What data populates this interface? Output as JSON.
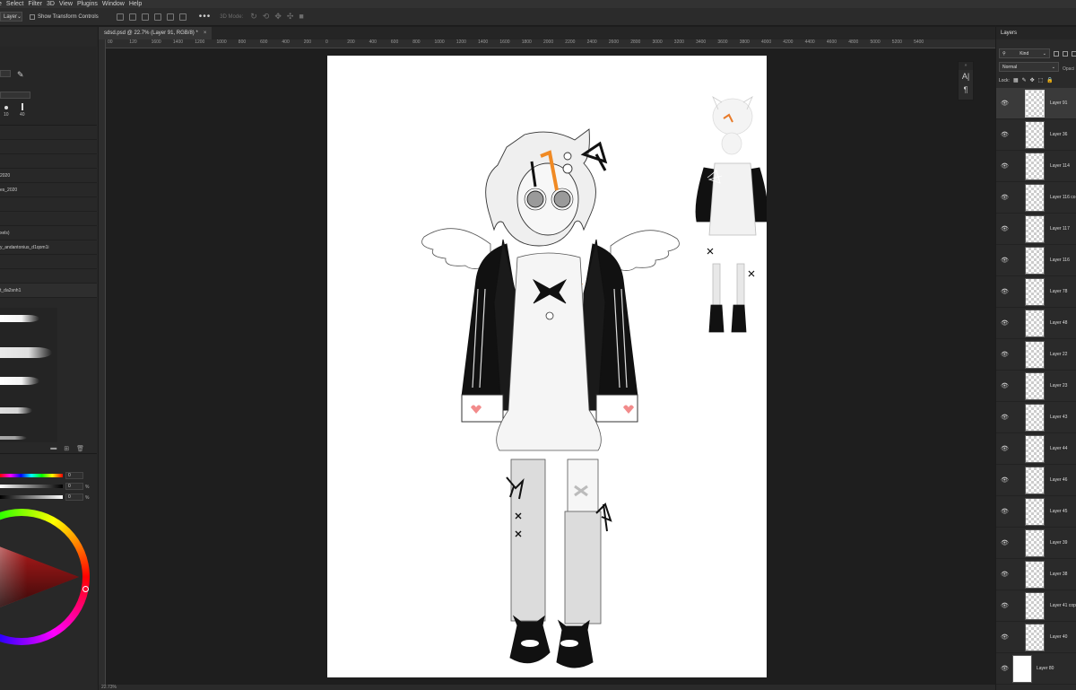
{
  "menu": [
    "e",
    "Select",
    "Filter",
    "3D",
    "View",
    "Plugins",
    "Window",
    "Help"
  ],
  "options": {
    "layer_select": "Layer",
    "transform_label": "Show Transform Controls",
    "more": "•••",
    "mode3d": "3D Mode:"
  },
  "document": {
    "tab_title": "sdsd.psd @ 22.7% (Layer 91, RGB/8) *",
    "close": "×",
    "status": "22.73%"
  },
  "ruler": {
    "h_ticks": [
      "00",
      "120",
      "1600",
      "1400",
      "1200",
      "1000",
      "800",
      "600",
      "400",
      "200",
      "0",
      "200",
      "400",
      "600",
      "800",
      "1000",
      "1200",
      "1400",
      "1600",
      "1800",
      "2000",
      "2200",
      "2400",
      "2600",
      "2800",
      "3000",
      "3200",
      "3400",
      "3600",
      "3800",
      "4000",
      "4200",
      "4400",
      "4600",
      "4800",
      "5000",
      "5200",
      "5400"
    ]
  },
  "brushes": {
    "size_1": "10",
    "size_2": "40",
    "presets": [
      "",
      "",
      "",
      "2020",
      "es_2020",
      "",
      "",
      "xels)",
      "y_andantonius_d1qom1i",
      "",
      "",
      "t_da2snh1"
    ]
  },
  "color": {
    "r": "0",
    "g": "0",
    "b": "0",
    "pct": "%",
    "accent": "#c81e1e"
  },
  "dock": {
    "header": "»",
    "icon1": "A|",
    "icon2": "¶"
  },
  "layers": {
    "tab": "Layers",
    "kind": "Kind",
    "blend": "Normal",
    "opacity": "Opaci",
    "lock": "Lock:",
    "items": [
      {
        "name": "Layer 91",
        "active": true
      },
      {
        "name": "Layer 36"
      },
      {
        "name": "Layer 114"
      },
      {
        "name": "Layer 116 co"
      },
      {
        "name": "Layer 117"
      },
      {
        "name": "Layer 116"
      },
      {
        "name": "Layer 78"
      },
      {
        "name": "Layer 48"
      },
      {
        "name": "Layer 22"
      },
      {
        "name": "Layer 23"
      },
      {
        "name": "Layer 43"
      },
      {
        "name": "Layer 44"
      },
      {
        "name": "Layer 46"
      },
      {
        "name": "Layer 45"
      },
      {
        "name": "Layer 39"
      },
      {
        "name": "Layer 38"
      },
      {
        "name": "Layer 41 cop"
      },
      {
        "name": "Layer 40"
      },
      {
        "name": "Layer 80",
        "bg": true
      }
    ]
  }
}
